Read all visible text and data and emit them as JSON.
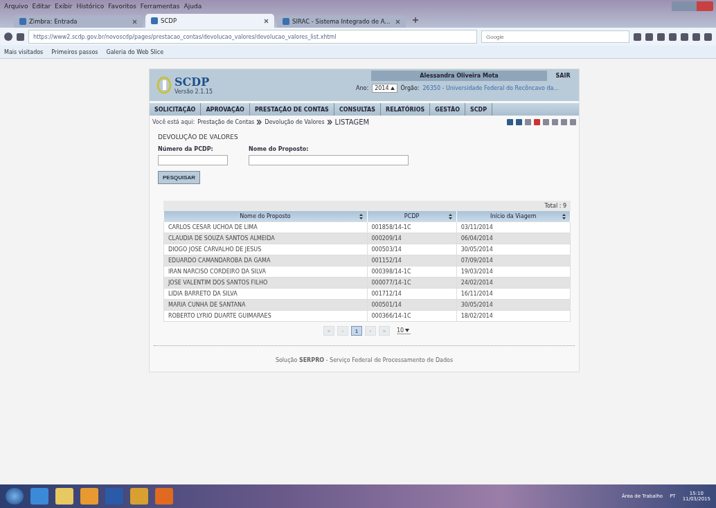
{
  "browser": {
    "menu": [
      "Arquivo",
      "Editar",
      "Exibir",
      "Histórico",
      "Favoritos",
      "Ferramentas",
      "Ajuda"
    ],
    "tabs": [
      {
        "label": "Zimbra: Entrada",
        "selected": false
      },
      {
        "label": "SCDP",
        "selected": true
      },
      {
        "label": "SIRAC - Sistema Integrado de A...",
        "selected": false
      }
    ],
    "url": "https://www2.scdp.gov.br/novoscdp/pages/prestacao_contas/devolucao_valores/devolucao_valores_list.xhtml",
    "search": {
      "placeholder": "Google"
    },
    "bookmarks": [
      "Mais visitados",
      "Primeiros passos",
      "Galeria do Web Slice"
    ]
  },
  "page": {
    "logo": "SCDP",
    "version": "Versão 2.1.15",
    "user": "Alessandra Oliveira Mota",
    "logout": "SAIR",
    "year_label": "Ano:",
    "year": "2014",
    "org_label": "Órgão:",
    "org": "26350 - Universidade Federal do Recôncavo da...",
    "nav": [
      "SOLICITAÇÃO",
      "APROVAÇÃO",
      "PRESTAÇÃO DE CONTAS",
      "CONSULTAS",
      "RELATÓRIOS",
      "GESTÃO",
      "SCDP"
    ],
    "breadcrumb": {
      "label": "Você está aqui:",
      "items": [
        "Prestação de Contas",
        "Devolução de Valores",
        "LISTAGEM"
      ]
    },
    "section_title": "DEVOLUÇÃO DE VALORES",
    "fields": [
      {
        "label": "Número da PCDP:"
      },
      {
        "label": "Nome do Proposto:"
      }
    ],
    "search_button": "PESQUISAR",
    "total": "Total : 9",
    "table": {
      "columns": [
        "Nome do Proposto",
        "PCDP",
        "Início da Viagem"
      ],
      "rows": [
        [
          "CARLOS CESAR UCHOA DE LIMA",
          "001858/14-1C",
          "03/11/2014"
        ],
        [
          "CLAUDIA DE SOUZA SANTOS ALMEIDA",
          "000209/14",
          "06/04/2014"
        ],
        [
          "DIOGO JOSE CARVALHO DE JESUS",
          "000503/14",
          "30/05/2014"
        ],
        [
          "EDUARDO CAMANDAROBA DA GAMA",
          "001152/14",
          "07/09/2014"
        ],
        [
          "IRAN NARCISO CORDEIRO DA SILVA",
          "000398/14-1C",
          "19/03/2014"
        ],
        [
          "JOSE VALENTIM DOS SANTOS FILHO",
          "000077/14-1C",
          "24/02/2014"
        ],
        [
          "LIDIA BARRETO DA SILVA",
          "001712/14",
          "16/11/2014"
        ],
        [
          "MARIA CUNHA DE SANTANA",
          "000501/14",
          "30/05/2014"
        ],
        [
          "ROBERTO LYRIO DUARTE GUIMARAES",
          "000366/14-1C",
          "18/02/2014"
        ]
      ]
    },
    "pagination": {
      "buttons": [
        {
          "label": "«",
          "selected": false
        },
        {
          "label": "‹",
          "selected": false
        },
        {
          "label": "1",
          "selected": true
        },
        {
          "label": "›",
          "selected": false
        },
        {
          "label": "»",
          "selected": false
        }
      ],
      "page_size": "10"
    },
    "footer": "Solução **SERPRO** - Serviço Federal de Processamento de Dados"
  },
  "taskbar": {
    "workspace": "Área de Trabalho",
    "language": "PT",
    "time": "15:10",
    "date": "11/03/2015"
  }
}
